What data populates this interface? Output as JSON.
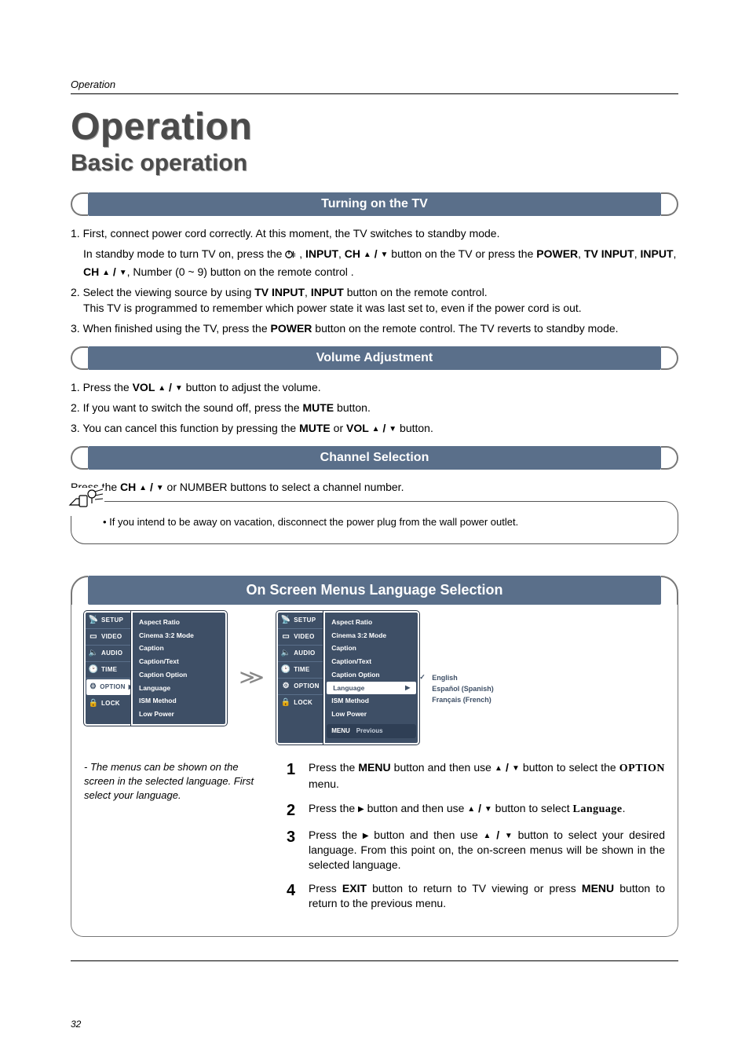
{
  "header": {
    "section_label": "Operation"
  },
  "titles": {
    "main": "Operation",
    "sub": "Basic operation"
  },
  "banners": {
    "turning_on": "Turning on the TV",
    "volume": "Volume Adjustment",
    "channel": "Channel Selection",
    "osd": "On Screen Menus Language Selection"
  },
  "turning_on": {
    "p1": "1. First, connect power cord correctly. At this moment, the TV switches to standby mode.",
    "p1b_pre": "In standby mode to turn TV on, press the ",
    "p1b_mid1": ", ",
    "p1b_input": "INPUT",
    "p1b_mid2": ", ",
    "p1b_ch": "CH",
    "p1b_mid3": " button on the TV or press the ",
    "p1b_power": "POWER",
    "p1b_mid4": ", ",
    "p1b_tvinput": "TV INPUT",
    "p1b_mid5": ", ",
    "p1b_input2": "INPUT",
    "p1b_mid6": ", ",
    "p1b_ch2": "CH",
    "p1b_tail": ", Number (0 ~ 9) button on the remote control .",
    "p2a": "2. Select the viewing source by using ",
    "p2_tvinput": "TV INPUT",
    "p2_mid": ", ",
    "p2_input": "INPUT",
    "p2b": " button on the remote control.",
    "p2c": "This TV is programmed to remember which power state it was last set to, even if the power cord is out.",
    "p3a": "3. When finished using the TV, press the ",
    "p3_power": "POWER",
    "p3b": " button on the remote control. The TV reverts to  standby mode."
  },
  "volume": {
    "p1a": "1. Press the ",
    "p1_vol": "VOL",
    "p1b": " button to adjust the volume.",
    "p2a": "2. If you want to switch the sound off, press the ",
    "p2_mute": "MUTE",
    "p2b": " button.",
    "p3a": "3. You can cancel this function by pressing the ",
    "p3_mute": "MUTE",
    "p3_or": " or ",
    "p3_vol": "VOL",
    "p3b": " button."
  },
  "channel": {
    "p1a": "Press the ",
    "p1_ch": "CH",
    "p1b": " or NUMBER buttons to select a channel number."
  },
  "note": {
    "bullet": "• If you intend to be away on vacation, disconnect the power plug from the wall power outlet."
  },
  "menu": {
    "tabs": [
      "SETUP",
      "VIDEO",
      "AUDIO",
      "TIME",
      "OPTION",
      "LOCK"
    ],
    "active_tab": "OPTION",
    "items": [
      "Aspect Ratio",
      "Cinema 3:2 Mode",
      "Caption",
      "Caption/Text",
      "Caption Option",
      "Language",
      "ISM Method",
      "Low Power"
    ],
    "active_item": "Language",
    "languages": [
      "English",
      "Español (Spanish)",
      "Français (French)"
    ],
    "selected_language": "English",
    "footer_menu": "MENU",
    "footer_prev": "Previous"
  },
  "caption": {
    "text": "- The menus can be shown on the screen in the selected language. First select your language."
  },
  "steps": {
    "s1a": "Press the ",
    "s1_menu": "MENU",
    "s1b": " button and then use ",
    "s1c": " button to select the ",
    "s1_option": "OPTION",
    "s1d": " menu.",
    "s2a": "Press the ",
    "s2b": " button and then use ",
    "s2c": " button to select ",
    "s2_lang": "Language",
    "s2d": ".",
    "s3a": "Press the ",
    "s3b": " button and then use ",
    "s3c": " button to select your desired language. From this point on, the on-screen menus will be shown in the selected language.",
    "s4a": "Press ",
    "s4_exit": "EXIT",
    "s4b": " button to return to TV viewing or press ",
    "s4_menu": "MENU",
    "s4c": " button to return to the previous menu."
  },
  "glyphs": {
    "up": "▲",
    "down": "▼",
    "right": "▶",
    "sep": " / ",
    "check": "✓",
    "arrow_double": "≫"
  },
  "page_number": "32"
}
